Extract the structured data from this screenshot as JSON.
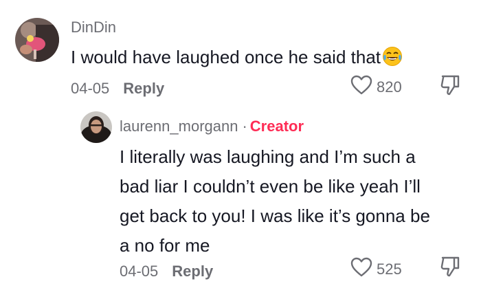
{
  "comments": [
    {
      "username": "DinDin",
      "text": "I would have laughed once he said that",
      "emoji": "face-with-tears-of-joy-icon",
      "date": "04-05",
      "reply_label": "Reply",
      "likes": "820"
    }
  ],
  "reply_comment": {
    "username": "laurenn_morgann",
    "separator": "·",
    "badge": "Creator",
    "text_lines": [
      "I literally was laughing and I’m such a",
      "bad liar I couldn’t even be like yeah I’ll",
      "get back to you! I was like it’s gonna be",
      "a no for me"
    ],
    "date": "04-05",
    "reply_label": "Reply",
    "likes": "525"
  },
  "colors": {
    "text": "#161823",
    "secondary": "#6c6d73",
    "creator": "#fe2c55"
  }
}
